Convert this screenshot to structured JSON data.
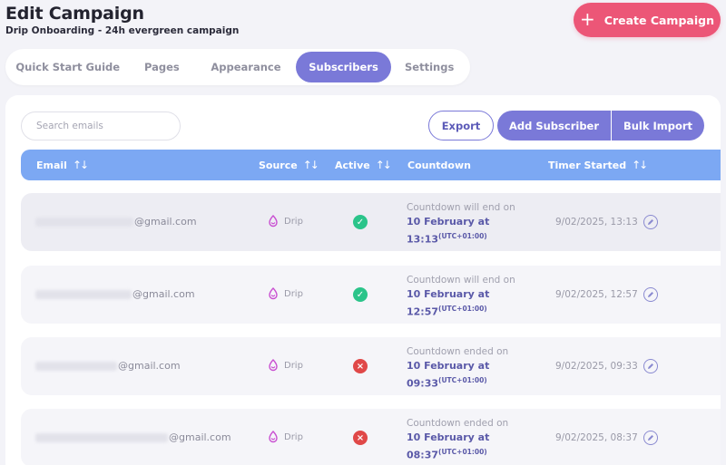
{
  "header": {
    "title": "Edit Campaign",
    "subtitle": "Drip Onboarding - 24h evergreen campaign",
    "create_label": "Create Campaign",
    "create_icon": "plus-icon"
  },
  "tabs": [
    {
      "label": "Quick Start Guide",
      "active": false
    },
    {
      "label": "Pages",
      "active": false
    },
    {
      "label": "Appearance",
      "active": false
    },
    {
      "label": "Subscribers",
      "active": true
    },
    {
      "label": "Settings",
      "active": false
    }
  ],
  "toolbar": {
    "search_placeholder": "Search emails",
    "export_label": "Export",
    "add_label": "Add Subscriber",
    "bulk_label": "Bulk Import"
  },
  "table": {
    "columns": [
      {
        "label": "Email",
        "sortable": true
      },
      {
        "label": "Source",
        "sortable": true
      },
      {
        "label": "Active",
        "sortable": true
      },
      {
        "label": "Countdown",
        "sortable": false
      },
      {
        "label": "Timer Started",
        "sortable": true
      }
    ],
    "rows": [
      {
        "email_domain": "@gmail.com",
        "source": "Drip",
        "active": true,
        "countdown_label": "Countdown will end on",
        "countdown_date": "10 February at",
        "countdown_time": "13:13",
        "countdown_tz": "(UTC+01:00)",
        "timer_started": "9/02/2025, 13:13"
      },
      {
        "email_domain": "@gmail.com",
        "source": "Drip",
        "active": true,
        "countdown_label": "Countdown will end on",
        "countdown_date": "10 February at",
        "countdown_time": "12:57",
        "countdown_tz": "(UTC+01:00)",
        "timer_started": "9/02/2025, 12:57"
      },
      {
        "email_domain": "@gmail.com",
        "source": "Drip",
        "active": false,
        "countdown_label": "Countdown ended on",
        "countdown_date": "10 February at",
        "countdown_time": "09:33",
        "countdown_tz": "(UTC+01:00)",
        "timer_started": "9/02/2025, 09:33"
      },
      {
        "email_domain": "@gmail.com",
        "source": "Drip",
        "active": false,
        "countdown_label": "Countdown ended on",
        "countdown_date": "10 February at",
        "countdown_time": "08:37",
        "countdown_tz": "(UTC+01:00)",
        "timer_started": "9/02/2025, 08:37"
      }
    ]
  },
  "colors": {
    "accent": "#7a79d8",
    "create_button": "#ec5677",
    "table_header": "#7ca8f3",
    "status_ok": "#2bc48a",
    "status_no": "#e04848"
  },
  "icons": {
    "sort": "sort-icon",
    "source": "drip-icon",
    "active_true": "check-circle-icon",
    "active_false": "x-circle-icon",
    "edit": "pencil-icon"
  }
}
